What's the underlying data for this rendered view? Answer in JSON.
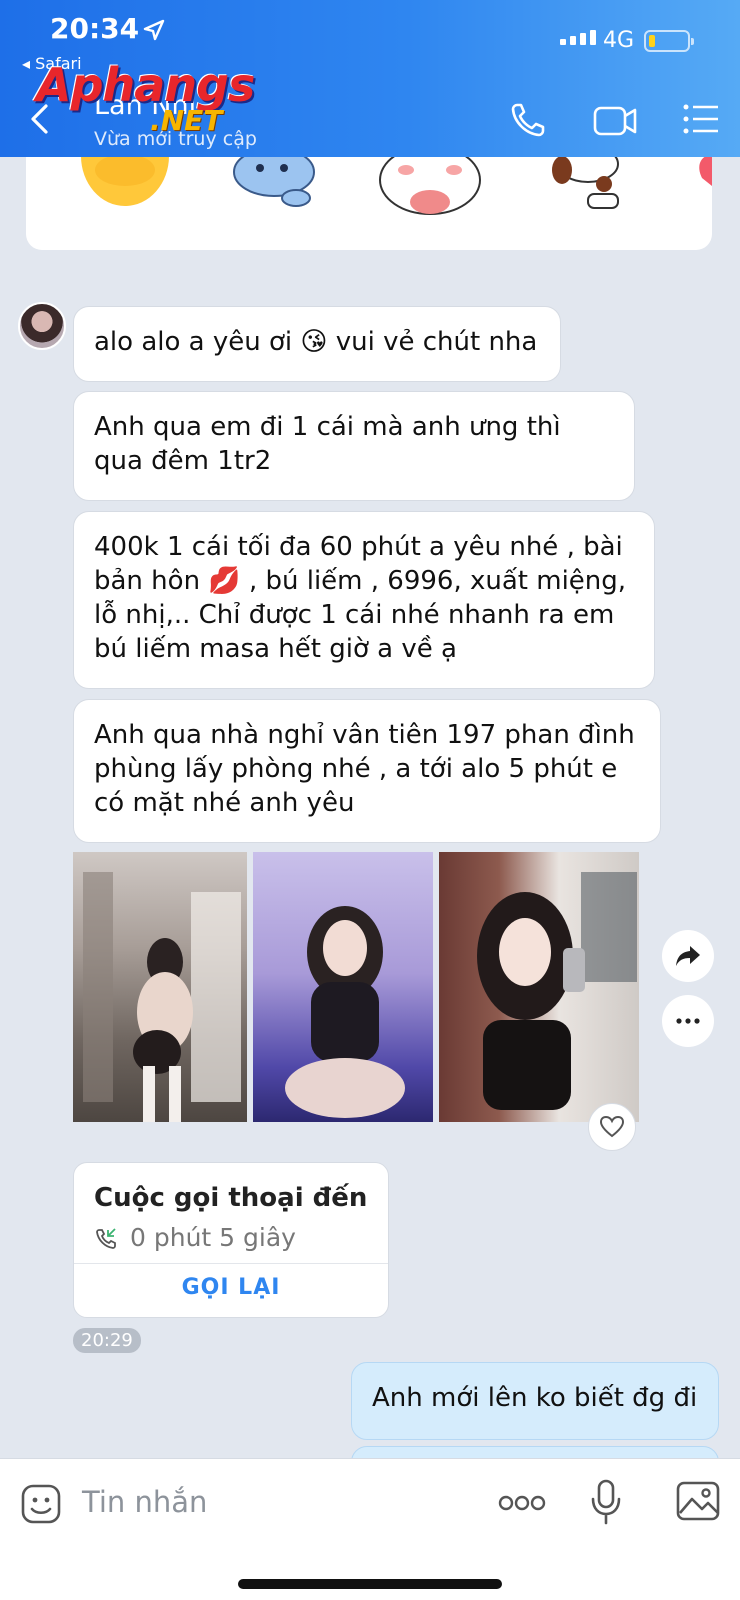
{
  "status_bar": {
    "time": "20:34",
    "back_app": "◂ Safari",
    "network": "4G"
  },
  "header": {
    "contact_name": "Lan Nhi",
    "contact_status": "Vừa mới truy cập"
  },
  "watermark": {
    "main": "Aphangs",
    "sub": ".NET"
  },
  "messages": [
    {
      "text": "alo alo a yêu ơi 😘 vui vẻ chút nha"
    },
    {
      "text": "Anh qua em đi 1 cái mà anh ưng thì qua đêm 1tr2"
    },
    {
      "text": "400k 1 cái tối đa 60 phút a yêu nhé , bài bản hôn 💋 , bú liếm , 6996, xuất miệng, lỗ nhị,.. Chỉ được 1 cái nhé nhanh ra em bú liếm masa hết giờ a về ạ"
    },
    {
      "text": "Anh qua  nhà nghỉ vân tiên 197 phan đình phùng lấy phòng nhé ,  a tới alo 5 phút  e có mặt  nhé anh yêu"
    }
  ],
  "call": {
    "title": "Cuộc gọi thoại đến",
    "duration": "0 phút 5 giây",
    "action": "GỌI LẠI",
    "time": "20:29"
  },
  "my_message": {
    "text": "Anh mới lên ko biết đg đi"
  },
  "input": {
    "placeholder": "Tin nhắn"
  },
  "colors": {
    "header_start": "#1e6fe8",
    "header_end": "#56aaf5",
    "accent": "#2f86f0",
    "mine_bubble": "#d5ecfc"
  }
}
